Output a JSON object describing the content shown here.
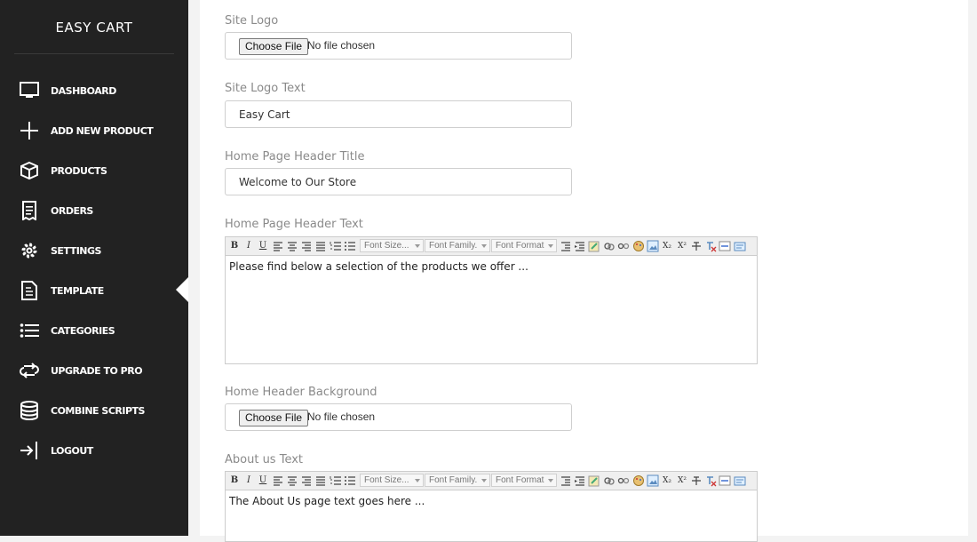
{
  "app": {
    "title": "EASY CART"
  },
  "sidebar": {
    "items": [
      {
        "label": "DASHBOARD",
        "icon": "monitor-icon"
      },
      {
        "label": "ADD NEW PRODUCT",
        "icon": "plus-icon"
      },
      {
        "label": "PRODUCTS",
        "icon": "box-icon"
      },
      {
        "label": "ORDERS",
        "icon": "receipt-icon"
      },
      {
        "label": "SETTINGS",
        "icon": "gear-icon"
      },
      {
        "label": "TEMPLATE",
        "icon": "file-icon",
        "active": true
      },
      {
        "label": "CATEGORIES",
        "icon": "list-icon"
      },
      {
        "label": "UPGRADE TO PRO",
        "icon": "refresh-icon"
      },
      {
        "label": "COMBINE SCRIPTS",
        "icon": "database-icon"
      },
      {
        "label": "LOGOUT",
        "icon": "logout-icon"
      }
    ]
  },
  "form": {
    "site_logo": {
      "label": "Site Logo",
      "button": "Choose File",
      "status": "No file chosen"
    },
    "site_logo_text": {
      "label": "Site Logo Text",
      "value": "Easy Cart"
    },
    "home_header_title": {
      "label": "Home Page Header Title",
      "value": "Welcome to Our Store"
    },
    "home_header_text": {
      "label": "Home Page Header Text",
      "value": "Please find below a selection of the products we offer ..."
    },
    "home_header_background": {
      "label": "Home Header Background",
      "button": "Choose File",
      "status": "No file chosen"
    },
    "about_us_text": {
      "label": "About us Text",
      "value": "The About Us page text goes here ..."
    }
  },
  "editor_toolbar": {
    "font_size": "Font Size...",
    "font_family": "Font Family.",
    "font_format": "Font Format",
    "bold": "B",
    "italic": "I",
    "underline": "U",
    "subscript": "X₂",
    "superscript": "X²"
  },
  "colors": {
    "sidebar_bg": "#222222",
    "content_bg": "#ffffff",
    "label_color": "#8a8a8a"
  }
}
